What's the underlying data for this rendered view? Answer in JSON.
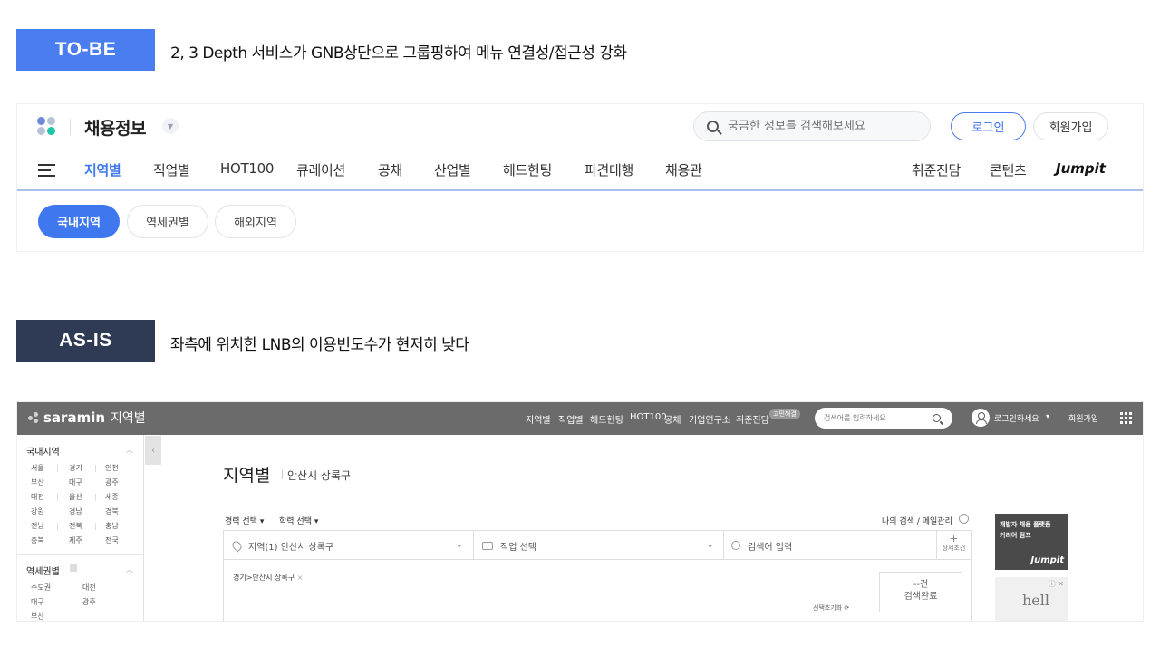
{
  "tobe": {
    "tag": "TO-BE",
    "headline": "2, 3 Depth 서비스가 GNB상단으로 그룹핑하여 메뉴 연결성/접근성 강화",
    "brand_title": "채용정보",
    "search_placeholder": "궁금한 정보를 검색해보세요",
    "login_label": "로그인",
    "join_label": "회원가입",
    "gnb_items": [
      "지역별",
      "직업별",
      "HOT100",
      "큐레이션",
      "공채",
      "산업별",
      "헤드헌팅",
      "파견대행",
      "채용관"
    ],
    "gnb_right": [
      "취준진담",
      "콘텐츠"
    ],
    "jumpit_logo": "Jumpit",
    "chips": [
      "국내지역",
      "역세권별",
      "해외지역"
    ],
    "colors": {
      "accent": "#3f78ee",
      "tag_tobe": "#4a7df0",
      "tag_asis": "#2f3a54"
    }
  },
  "asis": {
    "tag": "AS-IS",
    "headline": "좌측에 위치한 LNB의 이용빈도수가 현저히 낮다",
    "logo": "saramin",
    "logo_sub": "지역별",
    "topbar_menu": [
      "지역별",
      "직업별",
      "헤드헌팅",
      "HOT100",
      "공채",
      "기업연구소",
      "취준진담"
    ],
    "topbar_badge": "고민해결",
    "topbar_search_placeholder": "검색어를 입력하세요",
    "topbar_login": "로그인하세요",
    "topbar_join": "회원가입",
    "lnb": {
      "domestic_title": "국내지역",
      "domestic_regions": [
        "서울",
        "경기",
        "인천",
        "부산",
        "대구",
        "광주",
        "대전",
        "울산",
        "세종",
        "강원",
        "경남",
        "경북",
        "전남",
        "전북",
        "충남",
        "충북",
        "제주",
        "전국"
      ],
      "subway_title": "역세권별",
      "subway_regions": [
        "수도권",
        "대전",
        "대구",
        "광주",
        "부산"
      ]
    },
    "page_title": "지역별",
    "page_sub": "안산시 상록구",
    "filter_links": [
      "경력 선택",
      "학력 선택"
    ],
    "my_search": "나의 검색 / 메일관리",
    "filter_region": "지역(1) 안산시 상록구",
    "filter_job": "직업 선택",
    "filter_keyword": "검색어 입력",
    "detail_label": "상세조건",
    "selected_chip": "경기>안산시 상록구",
    "result_count": "--건",
    "result_label": "검색완료",
    "reset_label": "선택초기화",
    "ad_text_1": "개발자 채용 플랫폼",
    "ad_text_2": "커리어 점프",
    "ad_logo": "Jumpit",
    "ad2_logo": "hell"
  }
}
